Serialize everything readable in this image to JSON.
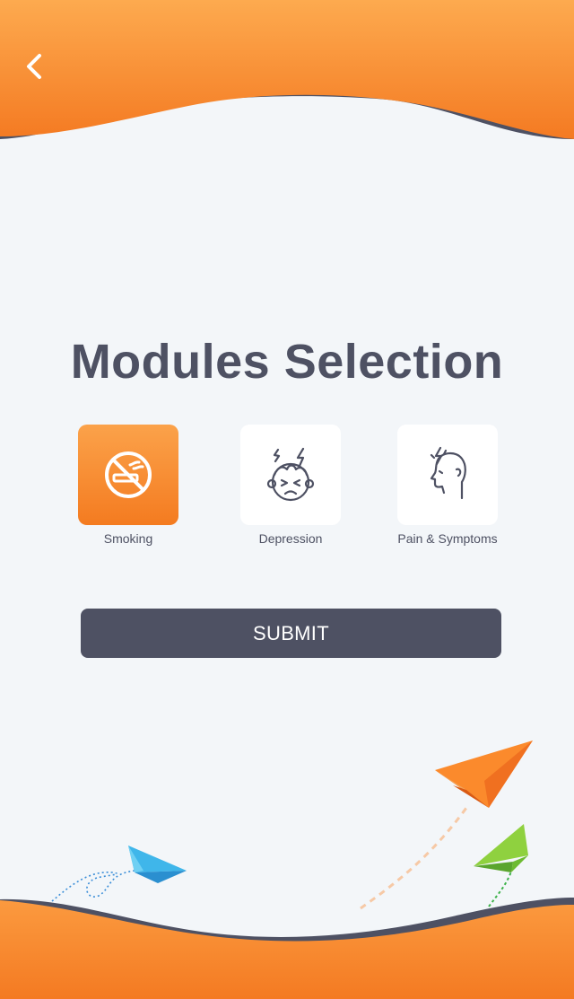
{
  "header": {
    "back_icon": "chevron-left-icon"
  },
  "page": {
    "title": "Modules Selection"
  },
  "modules": [
    {
      "label": "Smoking",
      "icon": "no-smoking-icon",
      "selected": true
    },
    {
      "label": "Depression",
      "icon": "stressed-face-icon",
      "selected": false
    },
    {
      "label": "Pain & Symptoms",
      "icon": "head-pain-icon",
      "selected": false
    }
  ],
  "actions": {
    "submit_label": "SUBMIT"
  },
  "colors": {
    "accent": "#f47b20",
    "accent_light": "#fba24a",
    "dark": "#4e5163",
    "background": "#f3f6f9"
  }
}
